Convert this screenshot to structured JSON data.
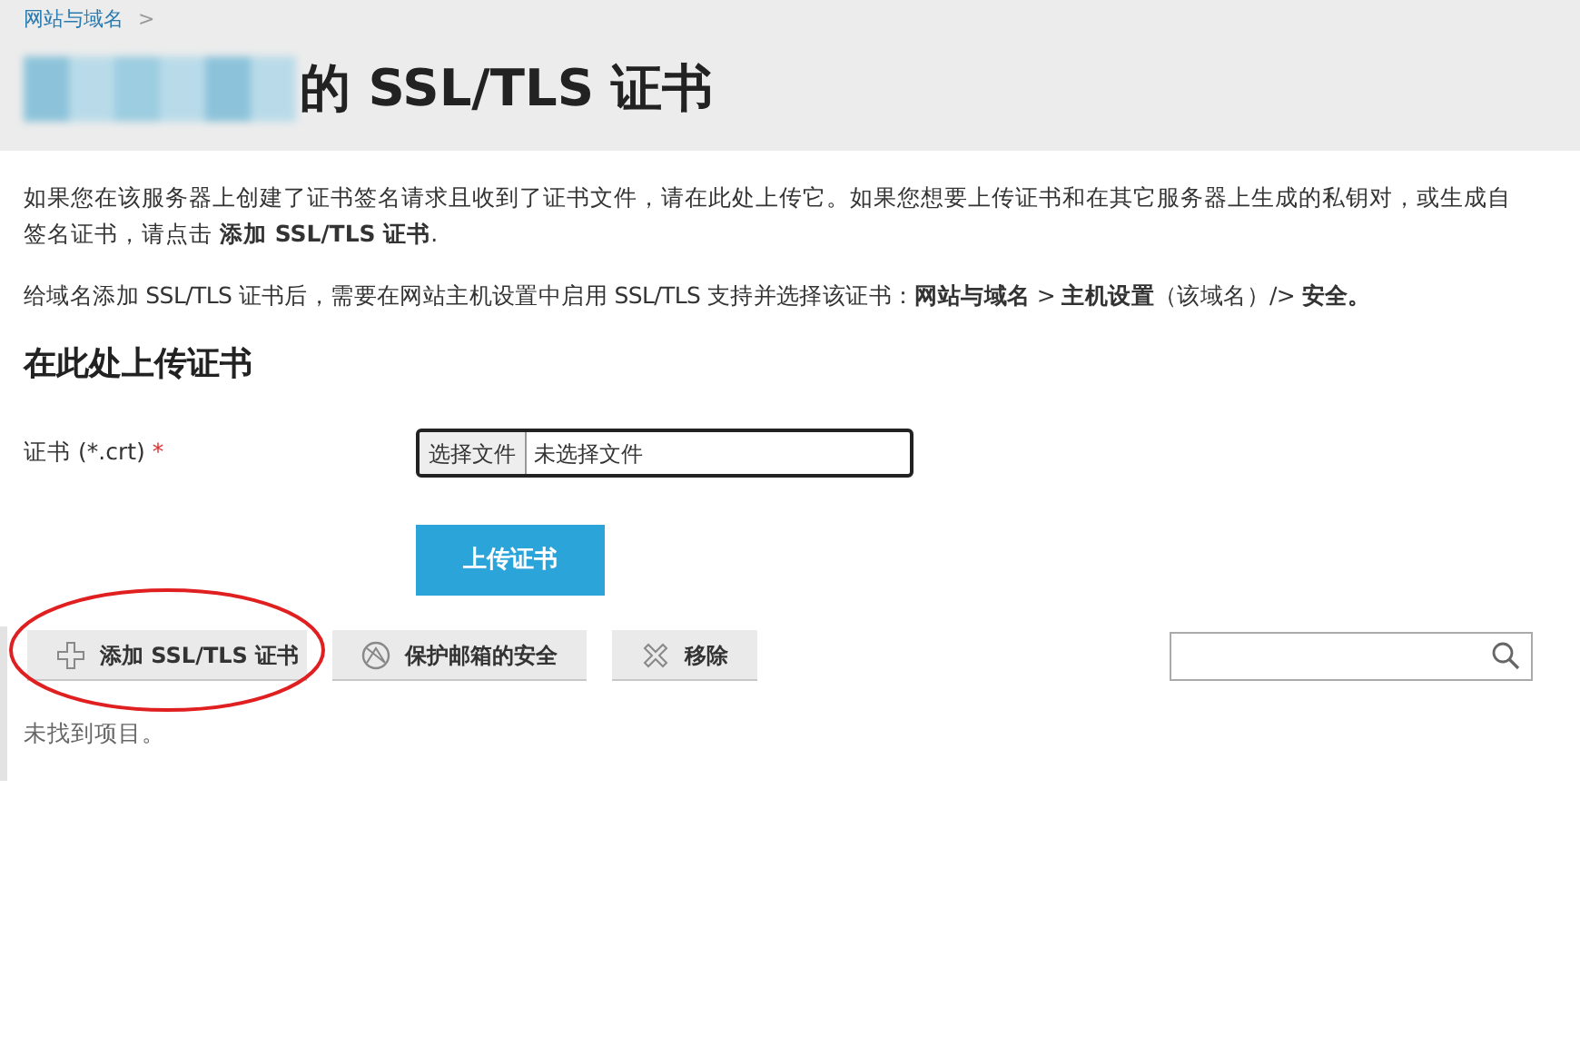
{
  "breadcrumb": {
    "label": "网站与域名",
    "separator": ">"
  },
  "title": "的 SSL/TLS 证书",
  "intro": [
    "如果您在该服务器上创建了证书签名请求且收到了证书文件，请在此处上传它。如果您想要上传证书和在其它服务器上生成的私钥对，或生成自签名证书，请点击 **添加 SSL/TLS 证书**.",
    "给域名添加 SSL/TLS 证书后，需要在网站主机设置中启用 SSL/TLS 支持并选择该证书：**网站与域名** > **主机设置**（该域名）/> **安全。**"
  ],
  "upload_section": {
    "heading": "在此处上传证书",
    "field_label": "证书 (*.crt)",
    "required_mark": "*",
    "file_button": "选择文件",
    "file_status": "未选择文件",
    "submit": "上传证书"
  },
  "toolbar": [
    {
      "kind": "add",
      "label": "添加 SSL/TLS 证书",
      "highlighted": true
    },
    {
      "kind": "protect",
      "label": "保护邮箱的安全",
      "highlighted": false
    },
    {
      "kind": "remove",
      "label": "移除",
      "highlighted": false
    }
  ],
  "empty_message": "未找到项目。"
}
